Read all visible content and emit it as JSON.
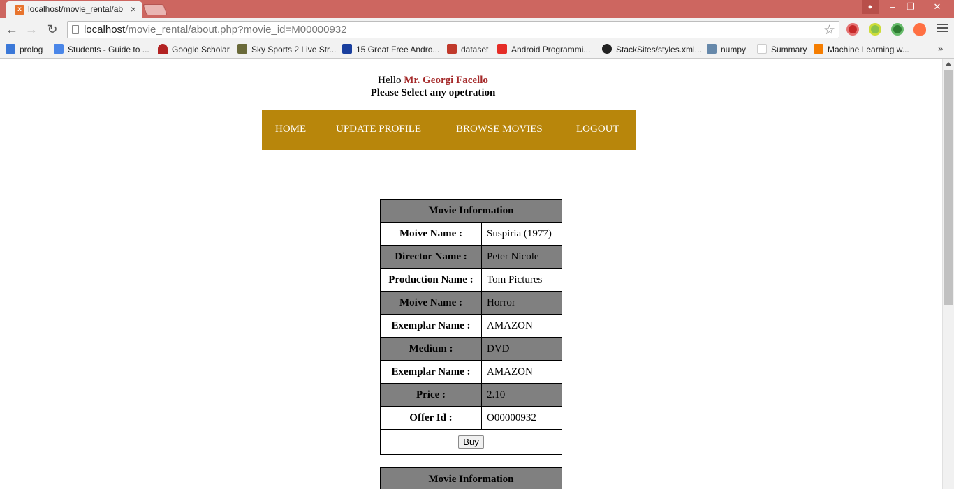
{
  "browser": {
    "tab_title": "localhost/movie_rental/ab",
    "tab_favicon": "x",
    "url_host": "localhost",
    "url_path": "/movie_rental/about.php?movie_id=M00000932",
    "bookmarks": [
      {
        "label": "prolog",
        "color": "#3b78d8"
      },
      {
        "label": "Students - Guide to ...",
        "color": "#4a86e8"
      },
      {
        "label": "Google Scholar",
        "color": "#b22222"
      },
      {
        "label": "Sky Sports 2 Live Str...",
        "color": "#6a6a3a"
      },
      {
        "label": "15 Great Free Andro...",
        "color": "#1a3f9e"
      },
      {
        "label": "dataset",
        "color": "#c0392b"
      },
      {
        "label": "Android Programmi...",
        "color": "#e52d27"
      },
      {
        "label": "StackSites/styles.xml...",
        "color": "#222222"
      },
      {
        "label": "numpy",
        "color": "#6688aa"
      },
      {
        "label": "Summary",
        "color": "#ffffff"
      },
      {
        "label": "Machine Learning w...",
        "color": "#f57d00"
      }
    ],
    "bookmarks_more": "»",
    "icons": {
      "back": "arrow-left-icon",
      "forward": "arrow-right-icon",
      "reload": "reload-icon",
      "star": "star-icon",
      "menu": "hamburger-menu-icon"
    }
  },
  "header": {
    "hello_prefix": "Hello",
    "user_name": "Mr. Georgi Facello",
    "prompt": "Please Select any opetration"
  },
  "nav": {
    "items": [
      "HOME",
      "UPDATE PROFILE",
      "BROWSE MOVIES",
      "LOGOUT"
    ],
    "bg_color": "#b8860b"
  },
  "movie_cards": [
    {
      "title": "Movie Information",
      "rows": [
        {
          "label": "Moive Name :",
          "value": "Suspiria (1977)"
        },
        {
          "label": "Director Name :",
          "value": "Peter Nicole"
        },
        {
          "label": "Production Name :",
          "value": "Tom Pictures"
        },
        {
          "label": "Moive Name :",
          "value": "Horror"
        },
        {
          "label": "Exemplar Name :",
          "value": "AMAZON"
        },
        {
          "label": "Medium :",
          "value": "DVD"
        },
        {
          "label": "Exemplar Name :",
          "value": "AMAZON"
        },
        {
          "label": "Price :",
          "value": "2.10"
        },
        {
          "label": "Offer Id :",
          "value": "O00000932"
        }
      ],
      "buy_label": "Buy"
    },
    {
      "title": "Movie Information"
    }
  ]
}
